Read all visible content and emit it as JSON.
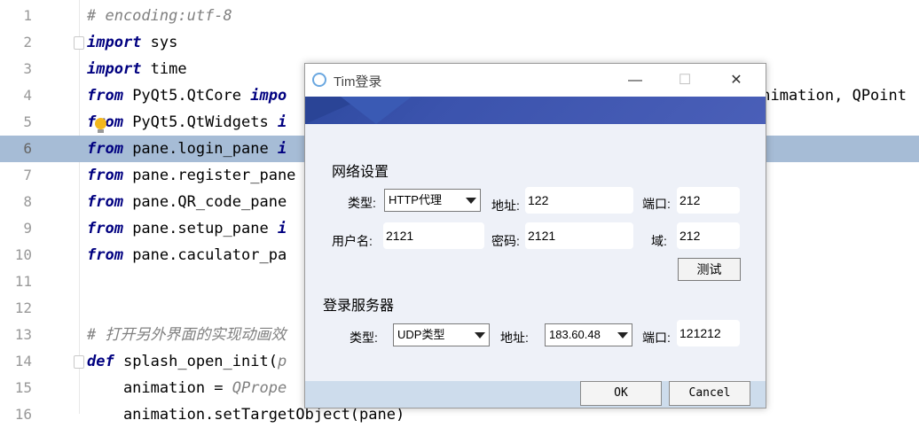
{
  "editor": {
    "lines": [
      {
        "n": "1",
        "parts": [
          {
            "t": "# encoding:utf-8",
            "c": "cm"
          }
        ]
      },
      {
        "n": "2",
        "parts": [
          {
            "t": "import",
            "c": "kw"
          },
          {
            "t": " sys",
            "c": "fn"
          }
        ]
      },
      {
        "n": "3",
        "parts": [
          {
            "t": "import",
            "c": "kw"
          },
          {
            "t": " time",
            "c": "fn"
          }
        ]
      },
      {
        "n": "4",
        "parts": [
          {
            "t": "from",
            "c": "kw"
          },
          {
            "t": " PyQt5.QtCore ",
            "c": "fn"
          },
          {
            "t": "impo",
            "c": "kw"
          }
        ]
      },
      {
        "n": "5",
        "parts": [
          {
            "t": "from",
            "c": "kw"
          },
          {
            "t": " PyQt5.QtWidgets ",
            "c": "fn"
          },
          {
            "t": "i",
            "c": "kw"
          }
        ]
      },
      {
        "n": "6",
        "parts": [
          {
            "t": "from",
            "c": "kw"
          },
          {
            "t": " pane.login_pane ",
            "c": "fn"
          },
          {
            "t": "i",
            "c": "kw"
          }
        ]
      },
      {
        "n": "7",
        "parts": [
          {
            "t": "from",
            "c": "kw"
          },
          {
            "t": " pane.register_pane",
            "c": "fn"
          }
        ]
      },
      {
        "n": "8",
        "parts": [
          {
            "t": "from",
            "c": "kw"
          },
          {
            "t": " pane.QR_code_pane",
            "c": "fn"
          }
        ]
      },
      {
        "n": "9",
        "parts": [
          {
            "t": "from",
            "c": "kw"
          },
          {
            "t": " pane.setup_pane ",
            "c": "fn"
          },
          {
            "t": "i",
            "c": "kw"
          }
        ]
      },
      {
        "n": "10",
        "parts": [
          {
            "t": "from",
            "c": "kw"
          },
          {
            "t": " pane.caculator_pa",
            "c": "fn"
          }
        ]
      },
      {
        "n": "11",
        "parts": []
      },
      {
        "n": "12",
        "parts": []
      },
      {
        "n": "13",
        "parts": [
          {
            "t": "# 打开另外界面的实现动画效",
            "c": "cm"
          }
        ]
      },
      {
        "n": "14",
        "parts": [
          {
            "t": "def",
            "c": "kw"
          },
          {
            "t": " splash_open_init(",
            "c": "fn"
          },
          {
            "t": "p",
            "c": "cm"
          }
        ]
      },
      {
        "n": "15",
        "parts": [
          {
            "t": "    animation = ",
            "c": "fn"
          },
          {
            "t": "QPrope",
            "c": "cm"
          }
        ]
      },
      {
        "n": "16",
        "parts": [
          {
            "t": "    animation.setTargetObject(pane)",
            "c": "fn"
          }
        ]
      }
    ],
    "line4_tail": "Animation, QPoint"
  },
  "dialog": {
    "title": "Tim登录",
    "minimize": "—",
    "maximize": "☐",
    "close": "✕",
    "network_section": "网络设置",
    "type_label": "类型:",
    "proxy_type": "HTTP代理",
    "addr_label": "地址:",
    "proxy_addr": "122",
    "port_label": "端口:",
    "proxy_port": "212",
    "user_label": "用户名:",
    "username": "2121",
    "pwd_label": "密码:",
    "password": "2121",
    "domain_label": "域:",
    "domain": "212",
    "test_button": "测试",
    "server_section": "登录服务器",
    "server_type_label": "类型:",
    "server_type": "UDP类型",
    "server_addr_label": "地址:",
    "server_addr": "183.60.48",
    "server_port_label": "端口:",
    "server_port": "121212",
    "ok_button": "OK",
    "cancel_button": "Cancel"
  }
}
